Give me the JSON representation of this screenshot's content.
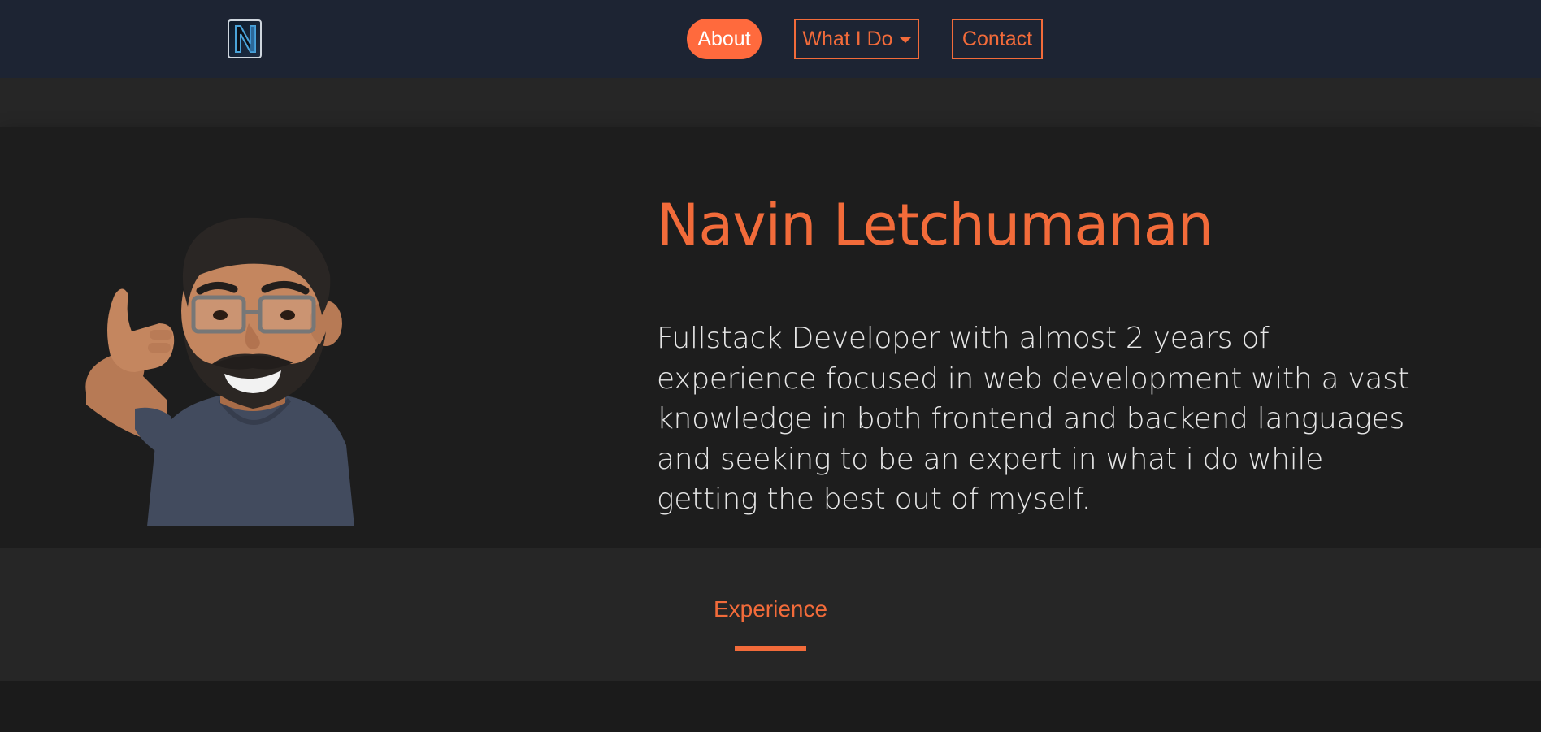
{
  "nav": {
    "logo_letter": "N",
    "about_label": "About",
    "what_i_do_label": "What I Do",
    "contact_label": "Contact"
  },
  "hero": {
    "name": "Navin Letchumanan",
    "bio": "Fullstack Developer with almost 2 years of experience focused in web development with a vast knowledge in both frontend and backend languages and seeking to be an expert in what i do while getting the best out of myself."
  },
  "experience": {
    "title": "Experience"
  },
  "colors": {
    "accent": "#f26b3a",
    "navbar": "#1d2433",
    "background": "#1b1b1b"
  }
}
